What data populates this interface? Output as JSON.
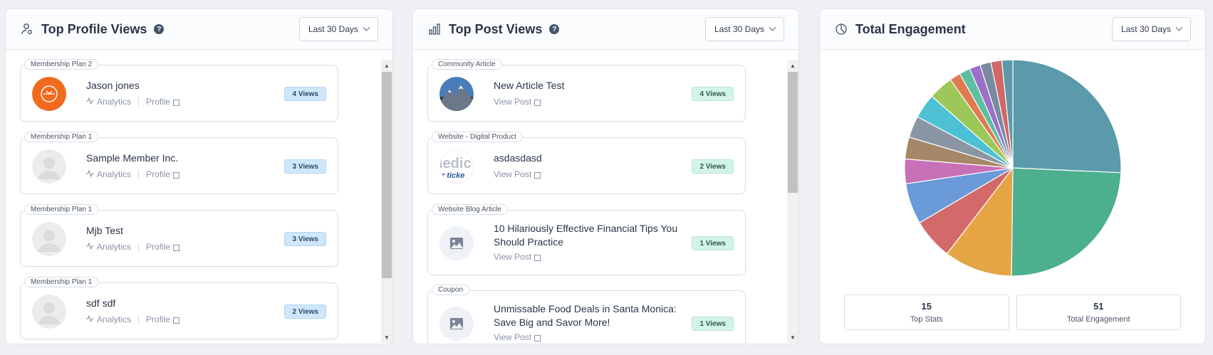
{
  "profile_panel": {
    "title": "Top Profile Views",
    "range": "Last 30 Days",
    "cards": [
      {
        "tag": "Membership Plan 2",
        "name": "Jason jones",
        "analytics": "Analytics",
        "profile": "Profile",
        "views": "4 Views",
        "avatar": "logo"
      },
      {
        "tag": "Membership Plan 1",
        "name": "Sample Member Inc.",
        "analytics": "Analytics",
        "profile": "Profile",
        "views": "3 Views",
        "avatar": "placeholder"
      },
      {
        "tag": "Membership Plan 1",
        "name": "Mjb Test",
        "analytics": "Analytics",
        "profile": "Profile",
        "views": "3 Views",
        "avatar": "placeholder"
      },
      {
        "tag": "Membership Plan 1",
        "name": "sdf sdf",
        "analytics": "Analytics",
        "profile": "Profile",
        "views": "2 Views",
        "avatar": "placeholder"
      }
    ]
  },
  "post_panel": {
    "title": "Top Post Views",
    "range": "Last 30 Days",
    "cards": [
      {
        "tag": "Community Article",
        "name": "New Article Test",
        "link": "View Post",
        "views": "4 Views",
        "thumb": "mountain"
      },
      {
        "tag": "Website - Digital Product",
        "name": "asdasdasd",
        "link": "View Post",
        "views": "2 Views",
        "thumb": "text-logo",
        "thumb_text_1": "ledic",
        "thumb_text_2": "r ticke"
      },
      {
        "tag": "Website Blog Article",
        "name": "10 Hilariously Effective Financial Tips You Should Practice",
        "link": "View Post",
        "views": "1 Views",
        "thumb": "image-icon"
      },
      {
        "tag": "Coupon",
        "name": "Unmissable Food Deals in Santa Monica: Save Big and Savor More!",
        "link": "View Post",
        "views": "1 Views",
        "thumb": "image-icon"
      }
    ]
  },
  "engagement_panel": {
    "title": "Total Engagement",
    "range": "Last 30 Days",
    "stats": [
      {
        "value": "15",
        "label": "Top Stats"
      },
      {
        "value": "51",
        "label": "Total Engagement"
      }
    ]
  },
  "chart_data": {
    "type": "pie",
    "title": "",
    "values": [
      12.6,
      12,
      5,
      3,
      3,
      1.8,
      1.6,
      1.6,
      1.8,
      1.8,
      0.8,
      0.8,
      0.8,
      0.8,
      0.8,
      0.8
    ],
    "colors": [
      "#5a9aab",
      "#4caf8e",
      "#e6a545",
      "#d26a6a",
      "#6a9ad8",
      "#c870b8",
      "#a58868",
      "#8a96a4",
      "#4ec0d4",
      "#9cc85a",
      "#e07a50",
      "#5cc0a0",
      "#9a70c8",
      "#7a8aa0",
      "#d06868",
      "#5a9aab"
    ]
  },
  "colors": {
    "accent_blue": "#cfe6fb",
    "accent_green": "#d4f3ea"
  }
}
